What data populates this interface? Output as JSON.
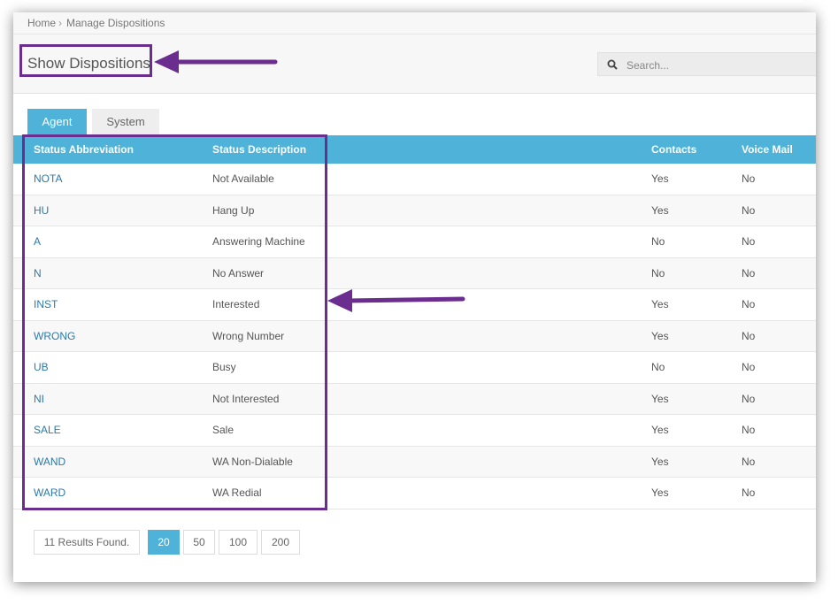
{
  "breadcrumb": {
    "home": "Home",
    "separator": "›",
    "current": "Manage Dispositions"
  },
  "header": {
    "title": "Show Dispositions"
  },
  "search": {
    "placeholder": "Search...",
    "icon": "search-icon"
  },
  "tabs": [
    {
      "label": "Agent",
      "active": true
    },
    {
      "label": "System",
      "active": false
    }
  ],
  "table": {
    "columns": [
      "Status Abbreviation",
      "Status Description",
      "Contacts",
      "Voice Mail"
    ],
    "rows": [
      {
        "abbr": "NOTA",
        "desc": "Not Available",
        "contacts": "Yes",
        "voicemail": "No"
      },
      {
        "abbr": "HU",
        "desc": "Hang Up",
        "contacts": "Yes",
        "voicemail": "No"
      },
      {
        "abbr": "A",
        "desc": "Answering Machine",
        "contacts": "No",
        "voicemail": "No"
      },
      {
        "abbr": "N",
        "desc": "No Answer",
        "contacts": "No",
        "voicemail": "No"
      },
      {
        "abbr": "INST",
        "desc": "Interested",
        "contacts": "Yes",
        "voicemail": "No"
      },
      {
        "abbr": "WRONG",
        "desc": "Wrong Number",
        "contacts": "Yes",
        "voicemail": "No"
      },
      {
        "abbr": "UB",
        "desc": "Busy",
        "contacts": "No",
        "voicemail": "No"
      },
      {
        "abbr": "NI",
        "desc": "Not Interested",
        "contacts": "Yes",
        "voicemail": "No"
      },
      {
        "abbr": "SALE",
        "desc": "Sale",
        "contacts": "Yes",
        "voicemail": "No"
      },
      {
        "abbr": "WAND",
        "desc": "WA Non-Dialable",
        "contacts": "Yes",
        "voicemail": "No"
      },
      {
        "abbr": "WARD",
        "desc": "WA Redial",
        "contacts": "Yes",
        "voicemail": "No"
      }
    ]
  },
  "footer": {
    "results": "11 Results Found.",
    "page_sizes": [
      "20",
      "50",
      "100",
      "200"
    ],
    "active_page_size": "20"
  },
  "colors": {
    "accent": "#4eb2d9",
    "annotation": "#6b2e8f",
    "link": "#2b79a8"
  }
}
